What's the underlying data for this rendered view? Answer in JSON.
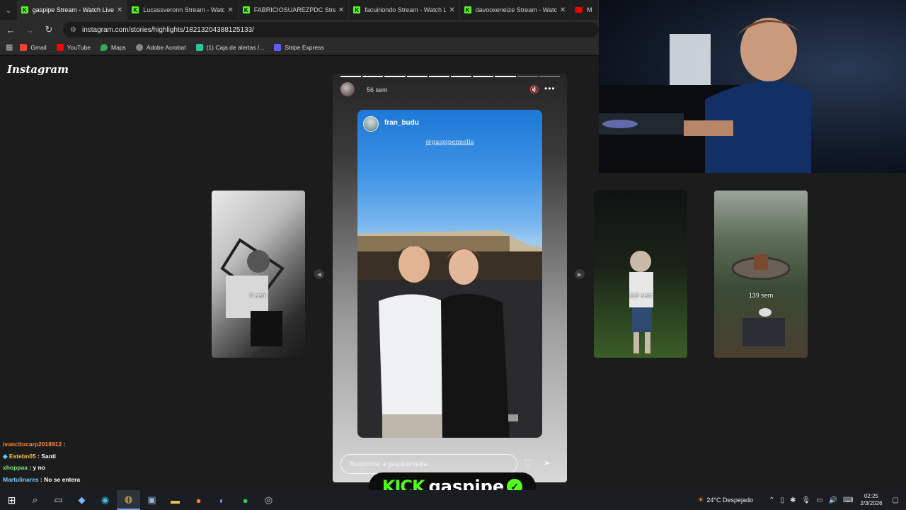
{
  "browser": {
    "tabs": [
      {
        "title": "gaspipe Stream - Watch Live on",
        "icon": "kick",
        "active": true
      },
      {
        "title": "Lucassveronn Stream - Watch Li",
        "icon": "kick"
      },
      {
        "title": "FABRICIOSUAREZPDC Stream -",
        "icon": "kick"
      },
      {
        "title": "facuiriondo Stream - Watch Live",
        "icon": "kick"
      },
      {
        "title": "davooxeneize Stream - Watch L",
        "icon": "kick"
      },
      {
        "title": "M",
        "icon": "youtube"
      }
    ],
    "url": "instagram.com/stories/highlights/18213204388125133/",
    "bookmarks": [
      {
        "label": "Gmail",
        "color": "#ea4335"
      },
      {
        "label": "YouTube",
        "color": "#ff0000"
      },
      {
        "label": "Maps",
        "color": "#34a853"
      },
      {
        "label": "Adobe Acrobat",
        "color": "#888888"
      },
      {
        "label": "(1) Caja de alertas /...",
        "color": "#20c997"
      },
      {
        "label": "Stripe Express",
        "color": "#635bff"
      }
    ]
  },
  "instagram": {
    "logo": "Instagram",
    "side_stories": [
      {
        "age": "5 sem"
      },
      {
        "age": "113 sem"
      },
      {
        "age": "139 sem"
      }
    ],
    "story": {
      "age": "56 sem",
      "progress_total": 10,
      "progress_done": 8,
      "inner_username": "fran_budu",
      "inner_mention": "@gaspipennella",
      "reply_placeholder": "Responder a gaspipennella..."
    }
  },
  "chat": [
    {
      "user": "ivancitocarp2018912",
      "text": "",
      "color": "#ff8a3d"
    },
    {
      "user": "Estebn05",
      "text": "Santi",
      "color": "#f2c14e"
    },
    {
      "user": "xhoppaa",
      "text": "y no",
      "color": "#7ee27e"
    },
    {
      "user": "Martulinares",
      "text": "No se entera",
      "color": "#7fc8ff"
    }
  ],
  "overlay": {
    "kick_logo": "KICK",
    "streamer": "gaspipe"
  },
  "taskbar": {
    "weather": "24°C  Despejado",
    "time": "02:25",
    "date": "2/3/2026"
  }
}
